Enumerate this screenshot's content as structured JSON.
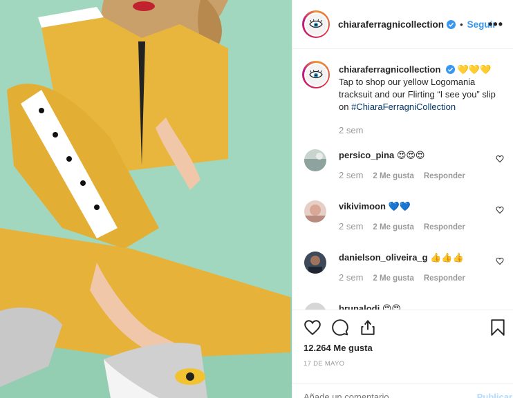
{
  "post": {
    "image_alt": "Model in yellow Logomania tracksuit and glitter slip-on shoes"
  },
  "header": {
    "username": "chiaraferragnicollection",
    "separator": "•",
    "follow_label": "Seguir",
    "more_icon": "more-dots-icon",
    "verified_icon": "verified-badge-icon"
  },
  "caption": {
    "username": "chiaraferragnicollection",
    "emojis": "💛💛💛",
    "text": "Tap to shop our yellow Logomania tracksuit and our Flirting “I see you” slip on ",
    "hashtag": "#ChiaraFerragniCollection",
    "time": "2 sem"
  },
  "comments": [
    {
      "username": "persico_pina",
      "text": "😍😍😍",
      "time": "2 sem",
      "likes": "2 Me gusta",
      "reply": "Responder"
    },
    {
      "username": "vikivimoon",
      "text": "💙💙",
      "time": "2 sem",
      "likes": "2 Me gusta",
      "reply": "Responder"
    },
    {
      "username": "danielson_oliveira_g",
      "text": "👍👍👍",
      "time": "2 sem",
      "likes": "2 Me gusta",
      "reply": "Responder"
    },
    {
      "username": "brunalodi",
      "text": "😍😍",
      "time": "",
      "likes": "",
      "reply": ""
    }
  ],
  "actions": {
    "like_icon": "heart-icon",
    "comment_icon": "comment-icon",
    "share_icon": "share-icon",
    "save_icon": "bookmark-icon",
    "likes_count": "12.264 Me gusta",
    "date": "17 DE MAYO"
  },
  "add_comment": {
    "placeholder": "Añade un comentario...",
    "publish_label": "Publicar"
  },
  "colors": {
    "link_blue": "#3897f0",
    "hashtag": "#003569",
    "muted": "#999999",
    "background_mint": "#9fd5bc",
    "tracksuit_yellow": "#e8b63c"
  }
}
